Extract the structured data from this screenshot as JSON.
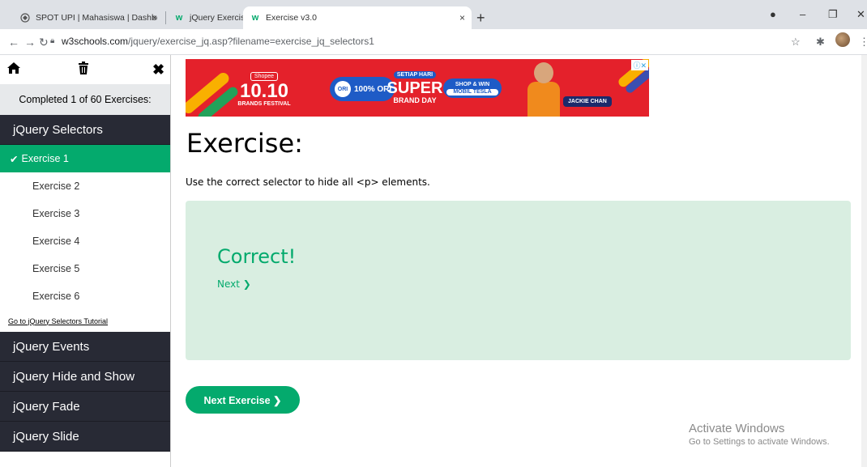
{
  "browser": {
    "tabs": [
      {
        "title": "SPOT UPI | Mahasiswa | Dashboa",
        "icon": "globe-icon"
      },
      {
        "title": "jQuery Exercises",
        "icon": "w3schools-icon"
      },
      {
        "title": "Exercise v3.0",
        "icon": "w3schools-icon"
      }
    ],
    "close_glyph": "×",
    "new_tab_glyph": "+",
    "url_host": "w3schools.com",
    "url_rest": "/jquery/exercise_jq.asp?filename=exercise_jq_selectors1"
  },
  "sidebar": {
    "progress": "Completed 1 of 60 Exercises:",
    "categories": {
      "selectors": "jQuery Selectors",
      "events": "jQuery Events",
      "hide_show": "jQuery Hide and Show",
      "fade": "jQuery Fade",
      "slide": "jQuery Slide"
    },
    "exercises": [
      "Exercise 1",
      "Exercise 2",
      "Exercise 3",
      "Exercise 4",
      "Exercise 5",
      "Exercise 6"
    ],
    "tutorial_link": "Go to jQuery Selectors Tutorial",
    "active_exercise": "Exercise 1"
  },
  "ad": {
    "shopee": "Shopee",
    "big": "10.10",
    "brands": "BRANDS FESTIVAL",
    "ori_badge": "ORI",
    "ori_pct": "100% ORI",
    "setiap": "SETIAP HARI",
    "super": "SUPER",
    "brand_day": "BRAND DAY",
    "shop_win": "SHOP & WIN",
    "mobil": "MOBIL TESLA",
    "jackie": "JACKIE CHAN"
  },
  "main": {
    "title": "Exercise:",
    "description": "Use the correct selector to hide all <p> elements.",
    "correct": "Correct!",
    "next_link": "Next ❯",
    "next_exercise": "Next Exercise ❯"
  },
  "watermark": {
    "line1": "Activate Windows",
    "line2": "Go to Settings to activate Windows."
  },
  "colors": {
    "accent": "#04aa6d",
    "sidebar_dark": "#282a35",
    "result_bg": "#d9eee1"
  }
}
